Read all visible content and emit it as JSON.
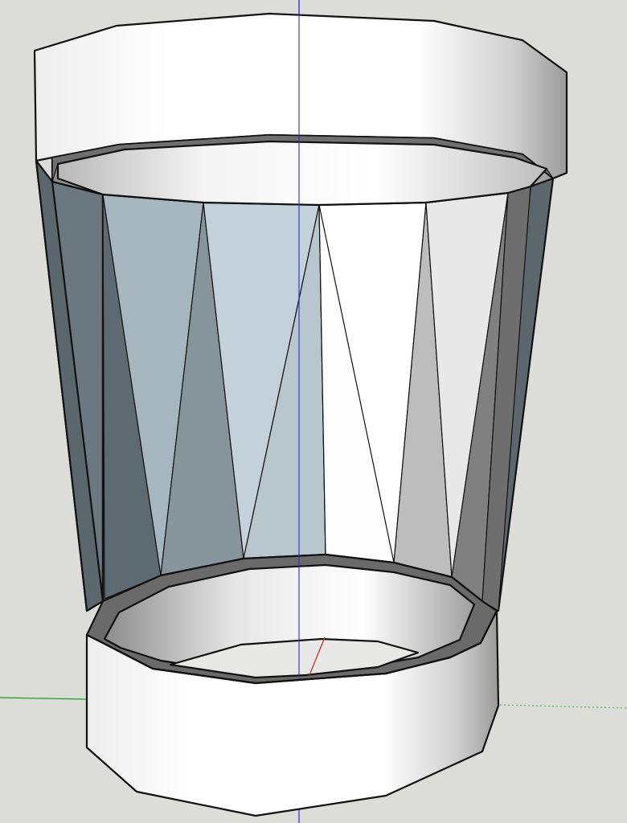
{
  "app": {
    "viewport_label": ""
  },
  "model": {
    "object": "lampshade-with-base",
    "faces": {
      "white": "#ffffff",
      "light_gray": "#e8e8e8",
      "mid_gray": "#bdbdbd",
      "dark_gray": "#808080",
      "slate_light": "#c3d2da",
      "slate_mid": "#a5b6bf",
      "slate_dark": "#6b7880",
      "slate_darker": "#5b666d",
      "edge": "#111111"
    }
  },
  "axes": {
    "blue": "#2b2bd6",
    "red": "#d42020",
    "green": "#1e9e1e",
    "green_dotted": "#4fbf4f"
  }
}
